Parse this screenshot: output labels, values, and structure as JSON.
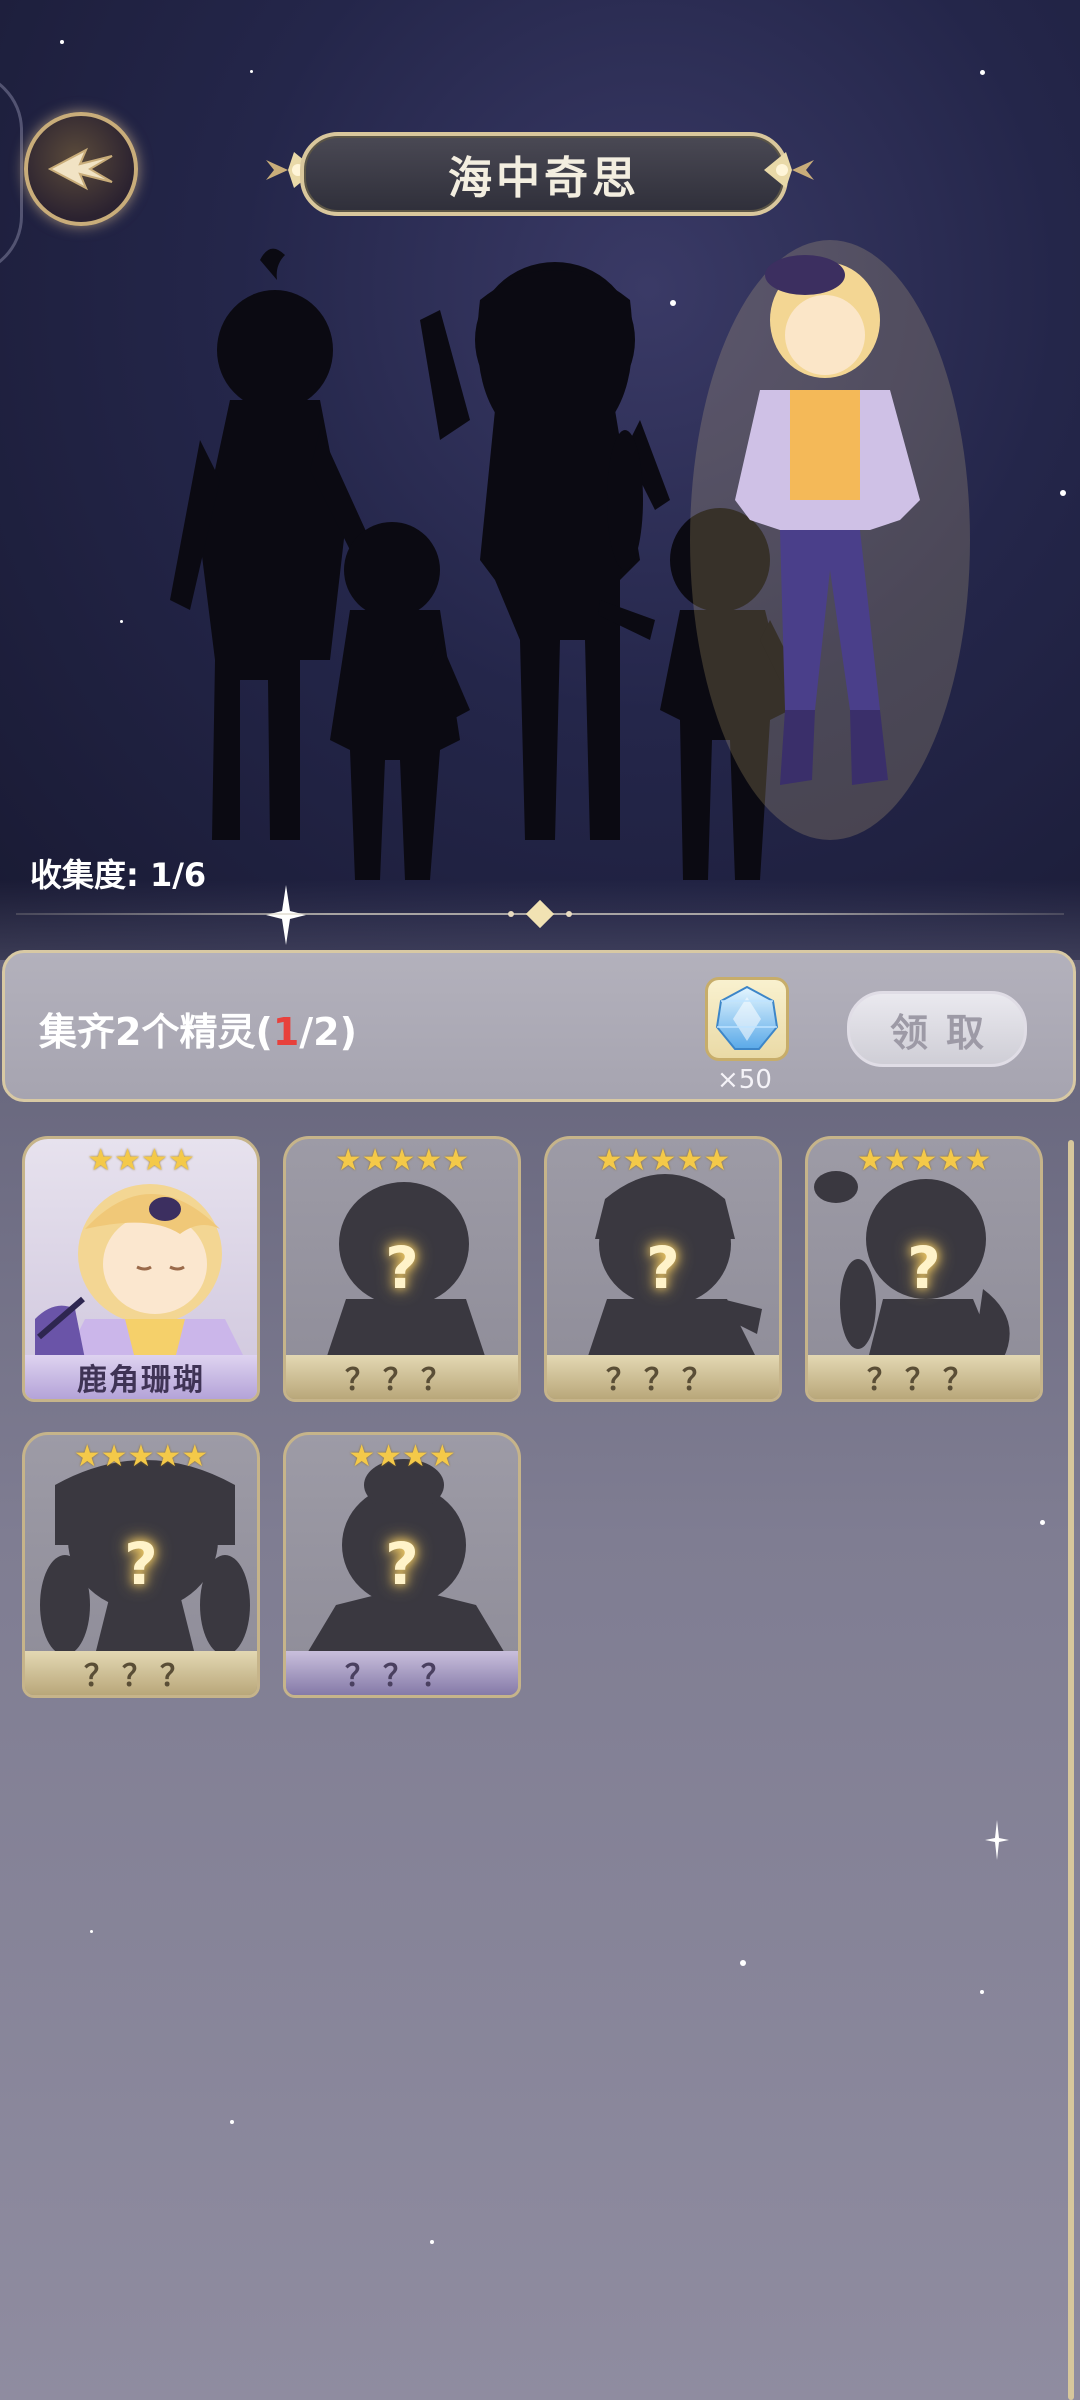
{
  "header": {
    "title": "海中奇思",
    "back_icon": "back-arrow-icon"
  },
  "progress": {
    "label": "收集度: 1/6",
    "collected": 1,
    "total": 6
  },
  "task": {
    "text_prefix": "集齐2个精灵(",
    "current": "1",
    "text_suffix": "/2)",
    "reward_icon": "crystal-icon",
    "reward_count": "×50",
    "claim_label": "领取"
  },
  "cards": [
    {
      "name": "鹿角珊瑚",
      "stars": "★★★★",
      "owned": true
    },
    {
      "name": "？？？",
      "stars": "★★★★★",
      "owned": false
    },
    {
      "name": "？？？",
      "stars": "★★★★★",
      "owned": false
    },
    {
      "name": "？？？",
      "stars": "★★★★★",
      "owned": false
    },
    {
      "name": "？？？",
      "stars": "★★★★★",
      "owned": false
    },
    {
      "name": "？？？",
      "stars": "★★★★",
      "owned": false
    }
  ],
  "unknown_mark": "?",
  "colors": {
    "accent_gold": "#d9c79c",
    "highlight_red": "#e8413c",
    "star_yellow": "#f4c949"
  }
}
